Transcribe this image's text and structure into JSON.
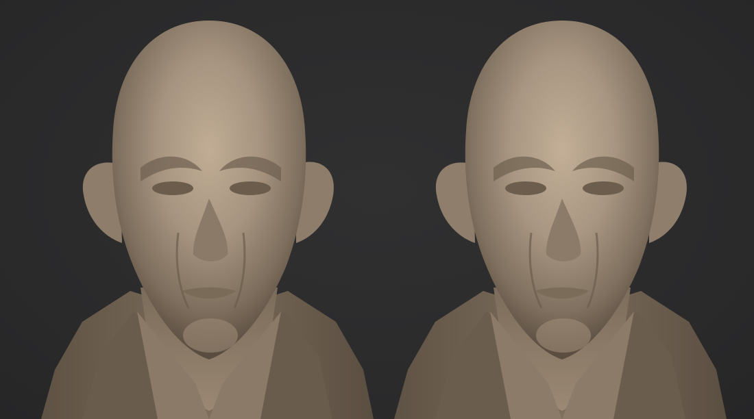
{
  "scene": {
    "background_color": "#2b2b2c",
    "material_color": "#9a8a77",
    "views": [
      {
        "id": "left",
        "description_icon": "sculpt-bust"
      },
      {
        "id": "right",
        "description_icon": "sculpt-bust"
      }
    ]
  }
}
